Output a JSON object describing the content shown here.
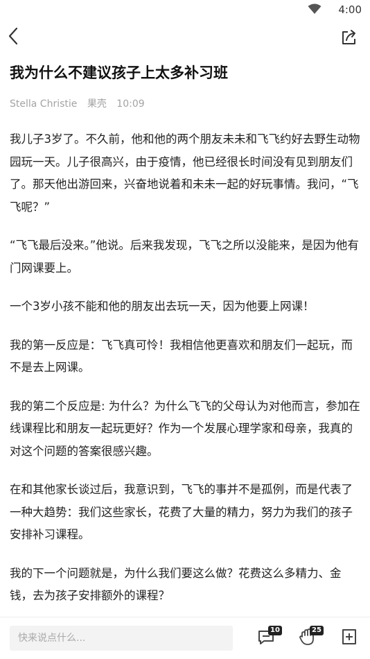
{
  "status_bar": {
    "time": "4:00",
    "icons": [
      "wifi-icon"
    ]
  },
  "toolbar": {
    "icons": [
      "back-arrow-icon",
      "share-icon"
    ]
  },
  "article": {
    "title": "我为什么不建议孩子上太多补习班",
    "author": "Stella Christie",
    "source": "果壳",
    "time": "10:09",
    "paragraphs": [
      "我儿子3岁了。不久前，他和他的两个朋友未未和飞飞约好去野生动物园玩一天。儿子很高兴，由于疫情，他已经很长时间没有见到朋友们了。那天他出游回来，兴奋地说着和未未一起的好玩事情。我问，“飞飞呢？”",
      "“飞飞最后没来。”他说。后来我发现，飞飞之所以没能来，是因为他有门网课要上。",
      "一个3岁小孩不能和他的朋友出去玩一天，因为他要上网课！",
      "我的第一反应是：飞飞真可怜！我相信他更喜欢和朋友们一起玩，而不是去上网课。",
      "我的第二个反应是: 为什么？为什么飞飞的父母认为对他而言，参加在线课程比和朋友一起玩更好？作为一个发展心理学家和母亲，我真的对这个问题的答案很感兴趣。",
      "在和其他家长谈过后，我意识到，飞飞的事并不是孤例，而是代表了一种大趋势：我们这些家长，花费了大量的精力，努力为我们的孩子安排补习课程。",
      "我的下一个问题就是，为什么我们要这么做？花费这么多精力、金钱，去为孩子安排额外的课程？"
    ]
  },
  "bottom_bar": {
    "comment_placeholder": "快来说点什么...",
    "comment_count": "10",
    "like_count": "25",
    "icons": [
      "comment-icon",
      "like-hand-icon",
      "bookmark-add-icon"
    ]
  }
}
